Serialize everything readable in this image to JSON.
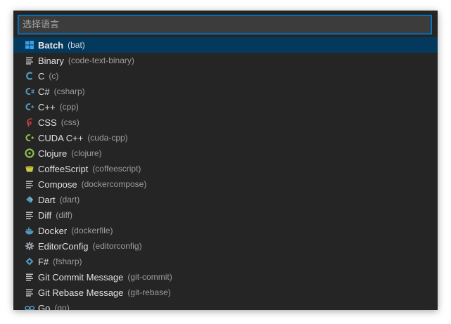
{
  "search": {
    "placeholder": "选择语言",
    "value": ""
  },
  "items": [
    {
      "label": "Batch",
      "id": "(bat)",
      "icon": "windows-icon",
      "color": "#3b9ee8",
      "selected": true
    },
    {
      "label": "Binary",
      "id": "(code-text-binary)",
      "icon": "lines-icon",
      "color": "#cccccc"
    },
    {
      "label": "C",
      "id": "(c)",
      "icon": "c-icon",
      "color": "#519aba"
    },
    {
      "label": "C#",
      "id": "(csharp)",
      "icon": "c-sharp-icon",
      "color": "#519aba"
    },
    {
      "label": "C++",
      "id": "(cpp)",
      "icon": "c-plus-plus-icon",
      "color": "#519aba"
    },
    {
      "label": "CSS",
      "id": "(css)",
      "icon": "css-icon",
      "color": "#cc3e44"
    },
    {
      "label": "CUDA C++",
      "id": "(cuda-cpp)",
      "icon": "cuda-icon",
      "color": "#8dc149"
    },
    {
      "label": "Clojure",
      "id": "(clojure)",
      "icon": "clojure-icon",
      "color": "#8dc149"
    },
    {
      "label": "CoffeeScript",
      "id": "(coffeescript)",
      "icon": "coffee-cup-icon",
      "color": "#cbcb41"
    },
    {
      "label": "Compose",
      "id": "(dockercompose)",
      "icon": "lines-icon",
      "color": "#cccccc"
    },
    {
      "label": "Dart",
      "id": "(dart)",
      "icon": "dart-icon",
      "color": "#519aba"
    },
    {
      "label": "Diff",
      "id": "(diff)",
      "icon": "lines-icon",
      "color": "#cccccc"
    },
    {
      "label": "Docker",
      "id": "(dockerfile)",
      "icon": "docker-whale-icon",
      "color": "#519aba"
    },
    {
      "label": "EditorConfig",
      "id": "(editorconfig)",
      "icon": "gear-icon",
      "color": "#9aa0a6"
    },
    {
      "label": "F#",
      "id": "(fsharp)",
      "icon": "fsharp-diamond-icon",
      "color": "#519aba"
    },
    {
      "label": "Git Commit Message",
      "id": "(git-commit)",
      "icon": "lines-icon",
      "color": "#cccccc"
    },
    {
      "label": "Git Rebase Message",
      "id": "(git-rebase)",
      "icon": "lines-icon",
      "color": "#cccccc"
    },
    {
      "label": "Go",
      "id": "(go)",
      "icon": "go-icon",
      "color": "#519aba"
    }
  ]
}
